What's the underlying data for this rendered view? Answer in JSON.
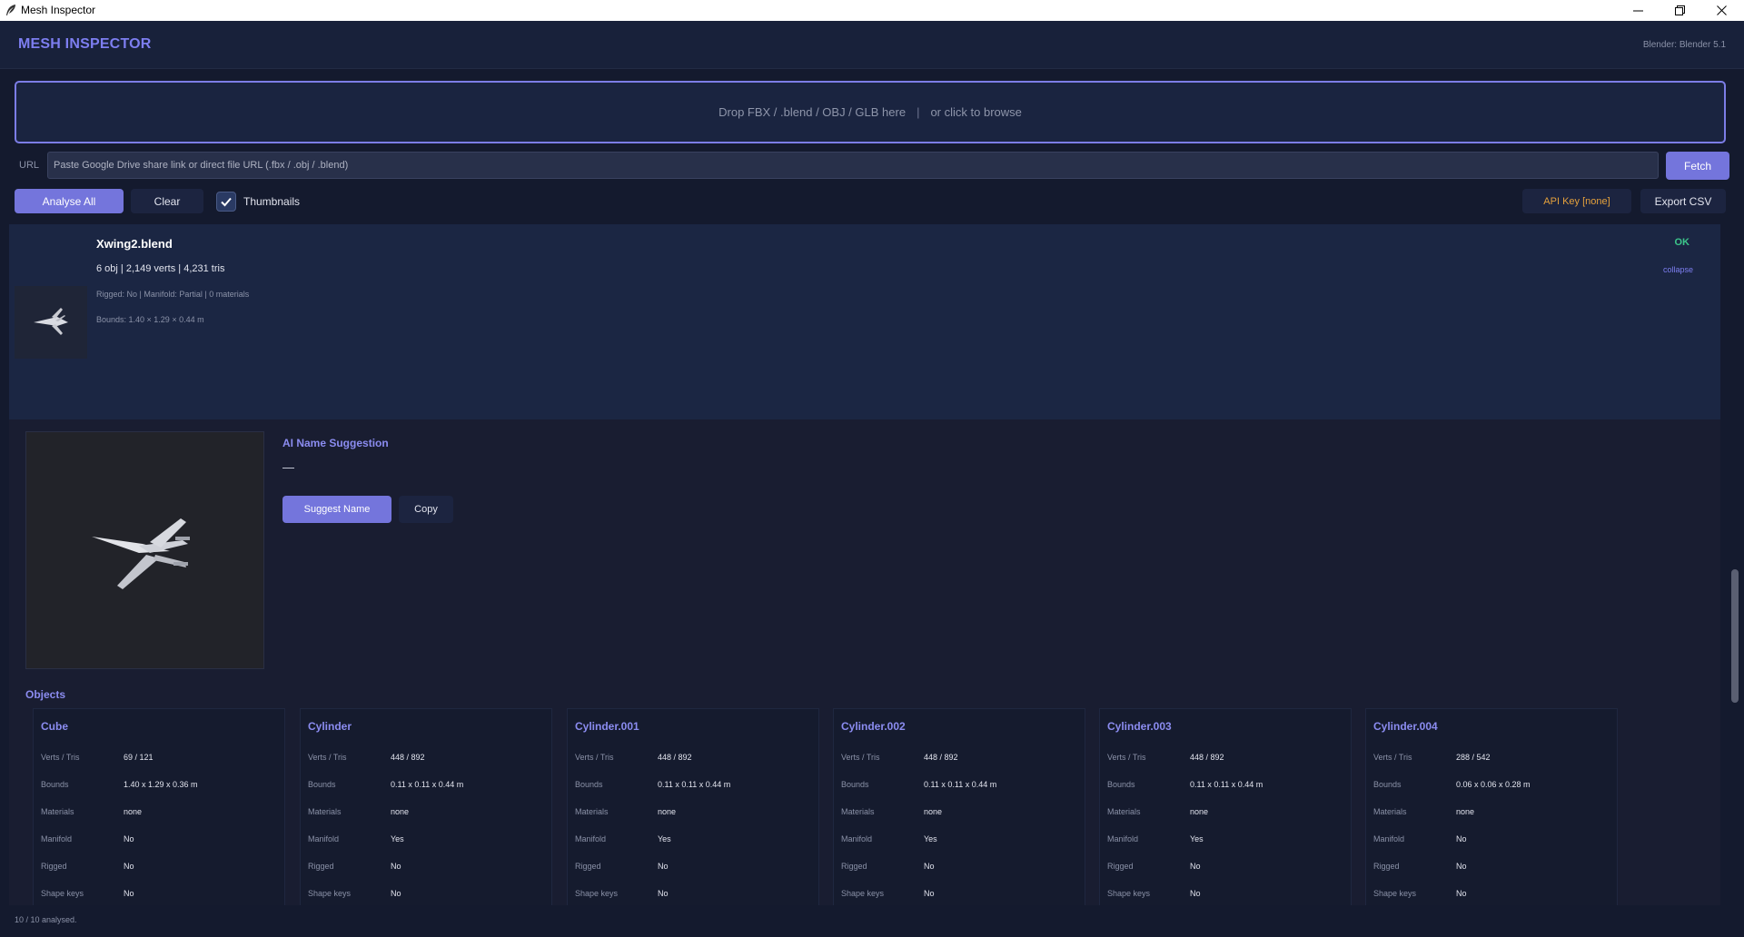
{
  "window": {
    "title": "Mesh Inspector",
    "controls": [
      "minimize-icon",
      "restore-icon",
      "close-icon"
    ]
  },
  "header": {
    "brand": "MESH INSPECTOR",
    "version": "Blender: Blender 5.1"
  },
  "dropzone": {
    "text": "Drop FBX / .blend / OBJ / GLB here",
    "separator": "|",
    "browse": "or click to browse"
  },
  "url": {
    "label": "URL",
    "placeholder": "Paste Google Drive share link or direct file URL (.fbx / .obj / .blend)",
    "value": "",
    "fetch_label": "Fetch"
  },
  "toolbar": {
    "analyse_label": "Analyse All",
    "clear_label": "Clear",
    "thumbnails_label": "Thumbnails",
    "thumbnails_checked": true,
    "api_key_label": "API Key [none]",
    "export_label": "Export CSV"
  },
  "file": {
    "name": "Xwing2.blend",
    "stats": "6 obj  |  2,149 verts  |  4,231 tris",
    "meta": "Rigged: No  |  Manifold: Partial  |  0 materials",
    "bounds": "Bounds: 1.40 × 1.29 × 0.44 m",
    "status": "OK",
    "collapse_label": "collapse"
  },
  "ai": {
    "title": "AI Name Suggestion",
    "value": "—",
    "suggest_label": "Suggest Name",
    "copy_label": "Copy"
  },
  "objects": {
    "title": "Objects",
    "labels": {
      "verts_tris": "Verts / Tris",
      "bounds": "Bounds",
      "materials": "Materials",
      "manifold": "Manifold",
      "rigged": "Rigged",
      "shape_keys": "Shape keys"
    },
    "items": [
      {
        "name": "Cube",
        "verts_tris": "69  /  121",
        "bounds": "1.40 x 1.29 x 0.36 m",
        "materials": "none",
        "manifold": "No",
        "rigged": "No",
        "shape_keys": "No"
      },
      {
        "name": "Cylinder",
        "verts_tris": "448  /  892",
        "bounds": "0.11 x 0.11 x 0.44 m",
        "materials": "none",
        "manifold": "Yes",
        "rigged": "No",
        "shape_keys": "No"
      },
      {
        "name": "Cylinder.001",
        "verts_tris": "448  /  892",
        "bounds": "0.11 x 0.11 x 0.44 m",
        "materials": "none",
        "manifold": "Yes",
        "rigged": "No",
        "shape_keys": "No"
      },
      {
        "name": "Cylinder.002",
        "verts_tris": "448  /  892",
        "bounds": "0.11 x 0.11 x 0.44 m",
        "materials": "none",
        "manifold": "Yes",
        "rigged": "No",
        "shape_keys": "No"
      },
      {
        "name": "Cylinder.003",
        "verts_tris": "448  /  892",
        "bounds": "0.11 x 0.11 x 0.44 m",
        "materials": "none",
        "manifold": "Yes",
        "rigged": "No",
        "shape_keys": "No"
      },
      {
        "name": "Cylinder.004",
        "verts_tris": "288  /  542",
        "bounds": "0.06 x 0.06 x 0.28 m",
        "materials": "none",
        "manifold": "No",
        "rigged": "No",
        "shape_keys": "No"
      }
    ]
  },
  "status": {
    "text": "10 / 10 analysed."
  },
  "colors": {
    "accent": "#7475dc",
    "ok": "#3cc68a",
    "warning": "#e5a13c",
    "background": "#141a2e"
  }
}
